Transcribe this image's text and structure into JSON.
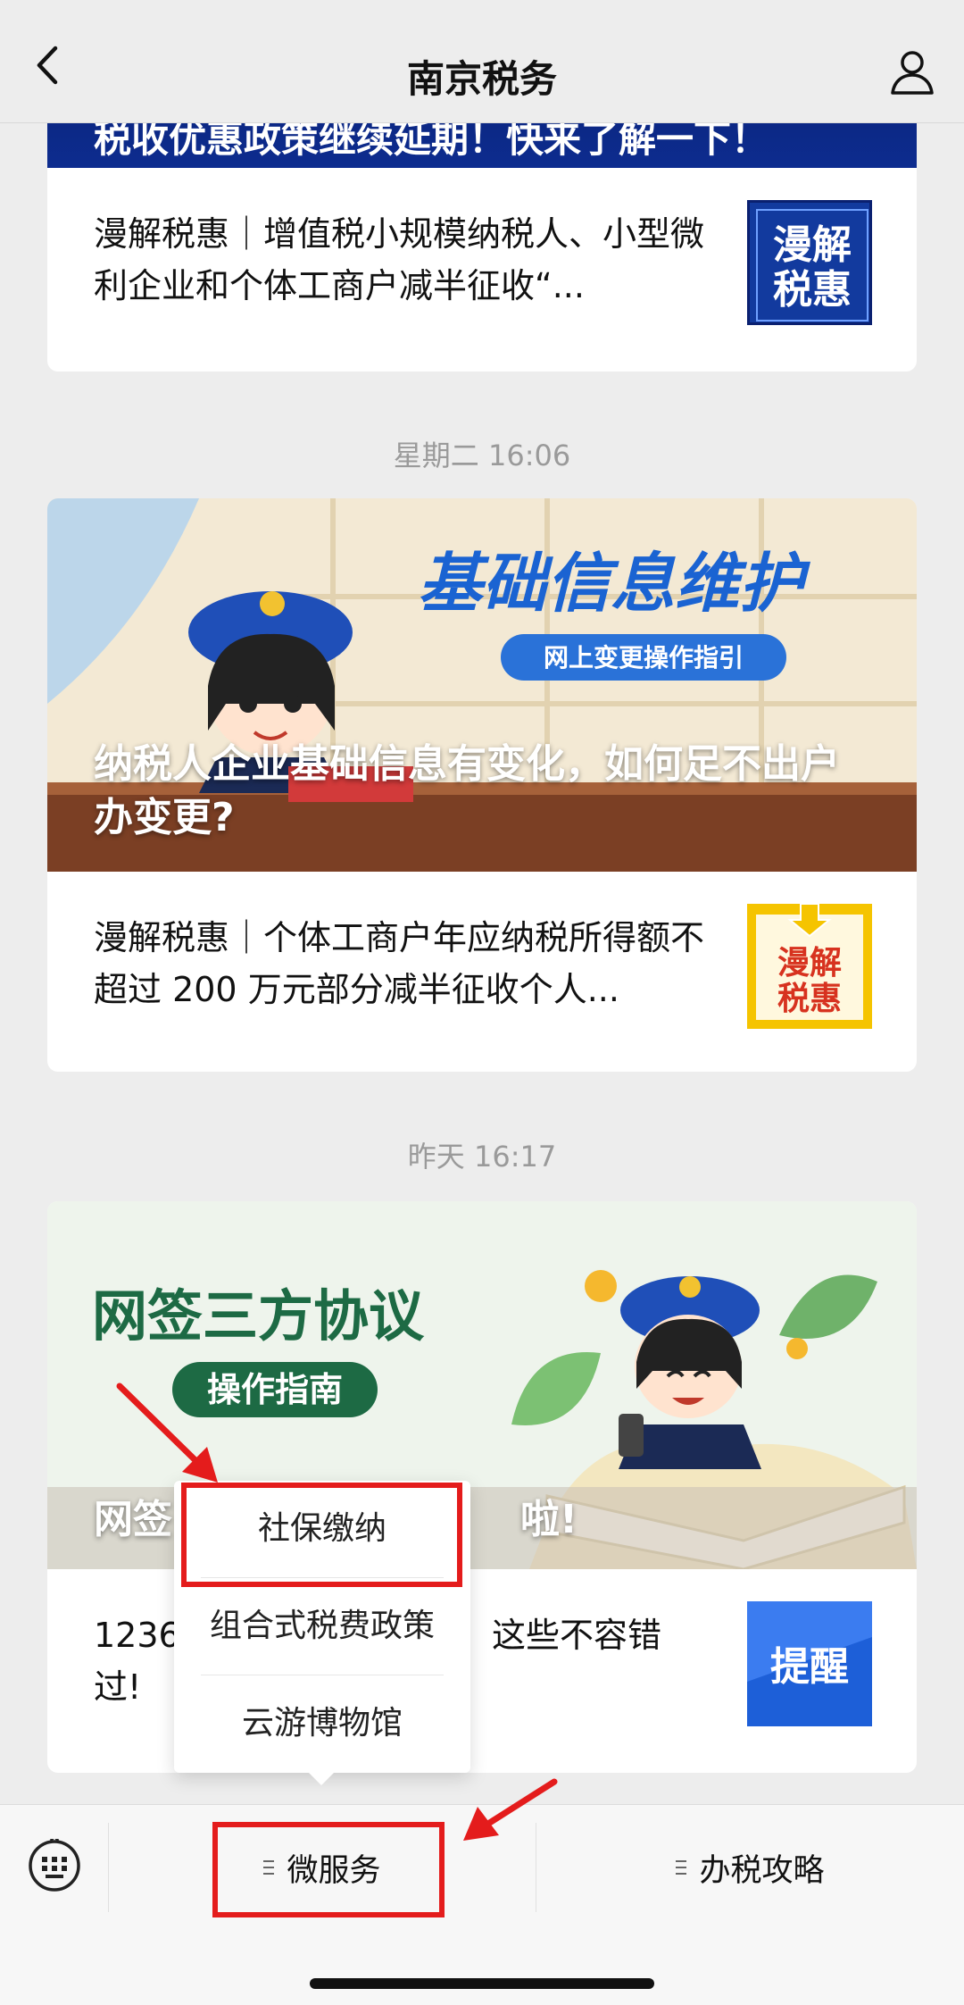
{
  "header": {
    "title": "南京税务"
  },
  "feed": {
    "card1": {
      "banner_title": "税收优惠政策继续延期！快来了解一下！",
      "article_text": "漫解税惠｜增值税小规模纳税人、小型微利企业和个体工商户减半征收“...",
      "thumb_text": "漫解税惠",
      "thumb_color": "#123a9e"
    },
    "timestamp2": "星期二 16:06",
    "card2": {
      "banner_heading": "基础信息维护",
      "banner_pill": "网上变更操作指引",
      "banner_title": "纳税人企业基础信息有变化，如何足不出户办变更?",
      "article_text": "漫解税惠｜个体工商户年应纳税所得额不超过 200 万元部分减半征收个人...",
      "thumb_text": "漫解税惠",
      "thumb_color": "#f5c400"
    },
    "timestamp3": "昨天 16:17",
    "card3": {
      "banner_heading": "网签三方协议",
      "banner_pill": "操作指南",
      "banner_title_left": "网签",
      "banner_title_right": "啦!",
      "article_text_left": "1236",
      "article_text_left2": "过!",
      "article_text_right": "这些不容错",
      "thumb_text": "提醒",
      "thumb_color": "#1d5fd8"
    }
  },
  "popup_menu": {
    "items": [
      {
        "label": "社保缴纳"
      },
      {
        "label": "组合式税费政策"
      },
      {
        "label": "云游博物馆"
      }
    ]
  },
  "bottom_menu": {
    "tabs": [
      {
        "label": "微服务"
      },
      {
        "label": "办税攻略"
      }
    ]
  },
  "colors": {
    "annotation": "#e41c1c",
    "background": "#ededed"
  }
}
